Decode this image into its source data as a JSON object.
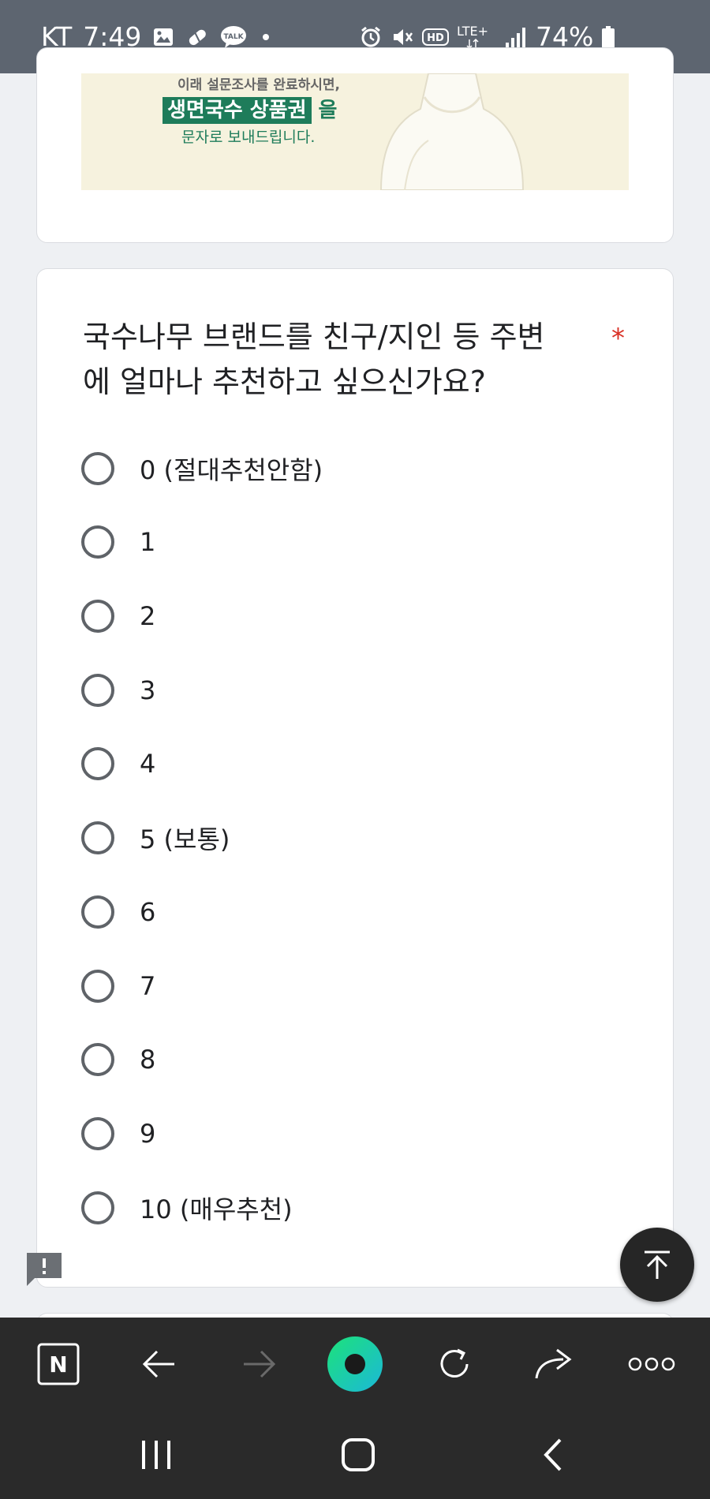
{
  "status_bar": {
    "carrier": "KT",
    "time": "7:49",
    "battery": "74%",
    "icons": [
      "gallery-icon",
      "pill-icon",
      "kakaotalk-icon",
      "dot-icon",
      "alarm-icon",
      "mute-icon",
      "hd-icon",
      "lte-icon",
      "signal-icon",
      "battery-icon"
    ],
    "talk_label": "TALK",
    "hd_label": "HD",
    "lte_label": "LTE+"
  },
  "banner": {
    "line1": "이래 설문조사를 완료하시면,",
    "highlight": "생면국수 상품권",
    "line2_suffix": " 을",
    "line3": "문자로 보내드립니다."
  },
  "question": {
    "title": "국수나무 브랜드를 친구/지인 등 주변에 얼마나 추천하고 싶으신가요?",
    "required_mark": "*",
    "options": [
      "0 (절대추천안함)",
      "1",
      "2",
      "3",
      "4",
      "5 (보통)",
      "6",
      "7",
      "8",
      "9",
      "10 (매우추천)"
    ]
  },
  "toolbar": {
    "items": [
      "naver-home-icon",
      "back-arrow-icon",
      "forward-arrow-icon",
      "green-dot-icon",
      "refresh-icon",
      "share-icon",
      "more-icon"
    ],
    "home_label": "N"
  },
  "navbar": {
    "items": [
      "recent-apps-icon",
      "home-icon",
      "back-icon"
    ]
  },
  "colors": {
    "status_bar": "#5d6570",
    "page_bg": "#eef0f3",
    "required": "#d93025",
    "toolbar_bg": "#2a2a2a",
    "accent_green": "#1e7c5a"
  }
}
